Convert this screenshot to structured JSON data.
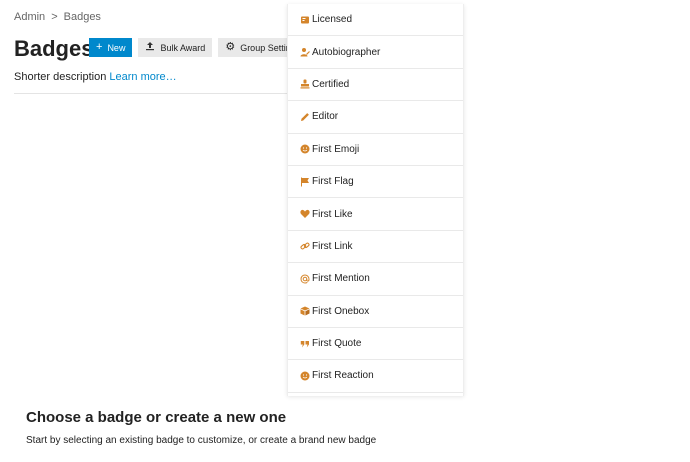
{
  "breadcrumb": {
    "root": "Admin",
    "separator": ">",
    "current": "Badges"
  },
  "header": {
    "title": "Badges"
  },
  "toolbar": {
    "new_label": "New",
    "bulk_award_label": "Bulk Award",
    "group_settings_label": "Group Settings"
  },
  "description": {
    "text": "Shorter description",
    "link": "Learn more…"
  },
  "badges": [
    {
      "label": "Licensed",
      "icon": "certificate-icon"
    },
    {
      "label": "Autobiographer",
      "icon": "user-pen-icon"
    },
    {
      "label": "Certified",
      "icon": "stamp-icon"
    },
    {
      "label": "Editor",
      "icon": "pencil-icon"
    },
    {
      "label": "First Emoji",
      "icon": "smile-icon"
    },
    {
      "label": "First Flag",
      "icon": "flag-icon"
    },
    {
      "label": "First Like",
      "icon": "heart-icon"
    },
    {
      "label": "First Link",
      "icon": "link-icon"
    },
    {
      "label": "First Mention",
      "icon": "at-icon"
    },
    {
      "label": "First Onebox",
      "icon": "cube-icon"
    },
    {
      "label": "First Quote",
      "icon": "quote-icon"
    },
    {
      "label": "First Reaction",
      "icon": "smile-icon"
    }
  ],
  "empty_state": {
    "title": "Choose a badge or create a new one",
    "subtitle": "Start by selecting an existing badge to customize, or create a brand new badge"
  },
  "colors": {
    "accent": "#0088cc",
    "icon": "#d4852b"
  }
}
